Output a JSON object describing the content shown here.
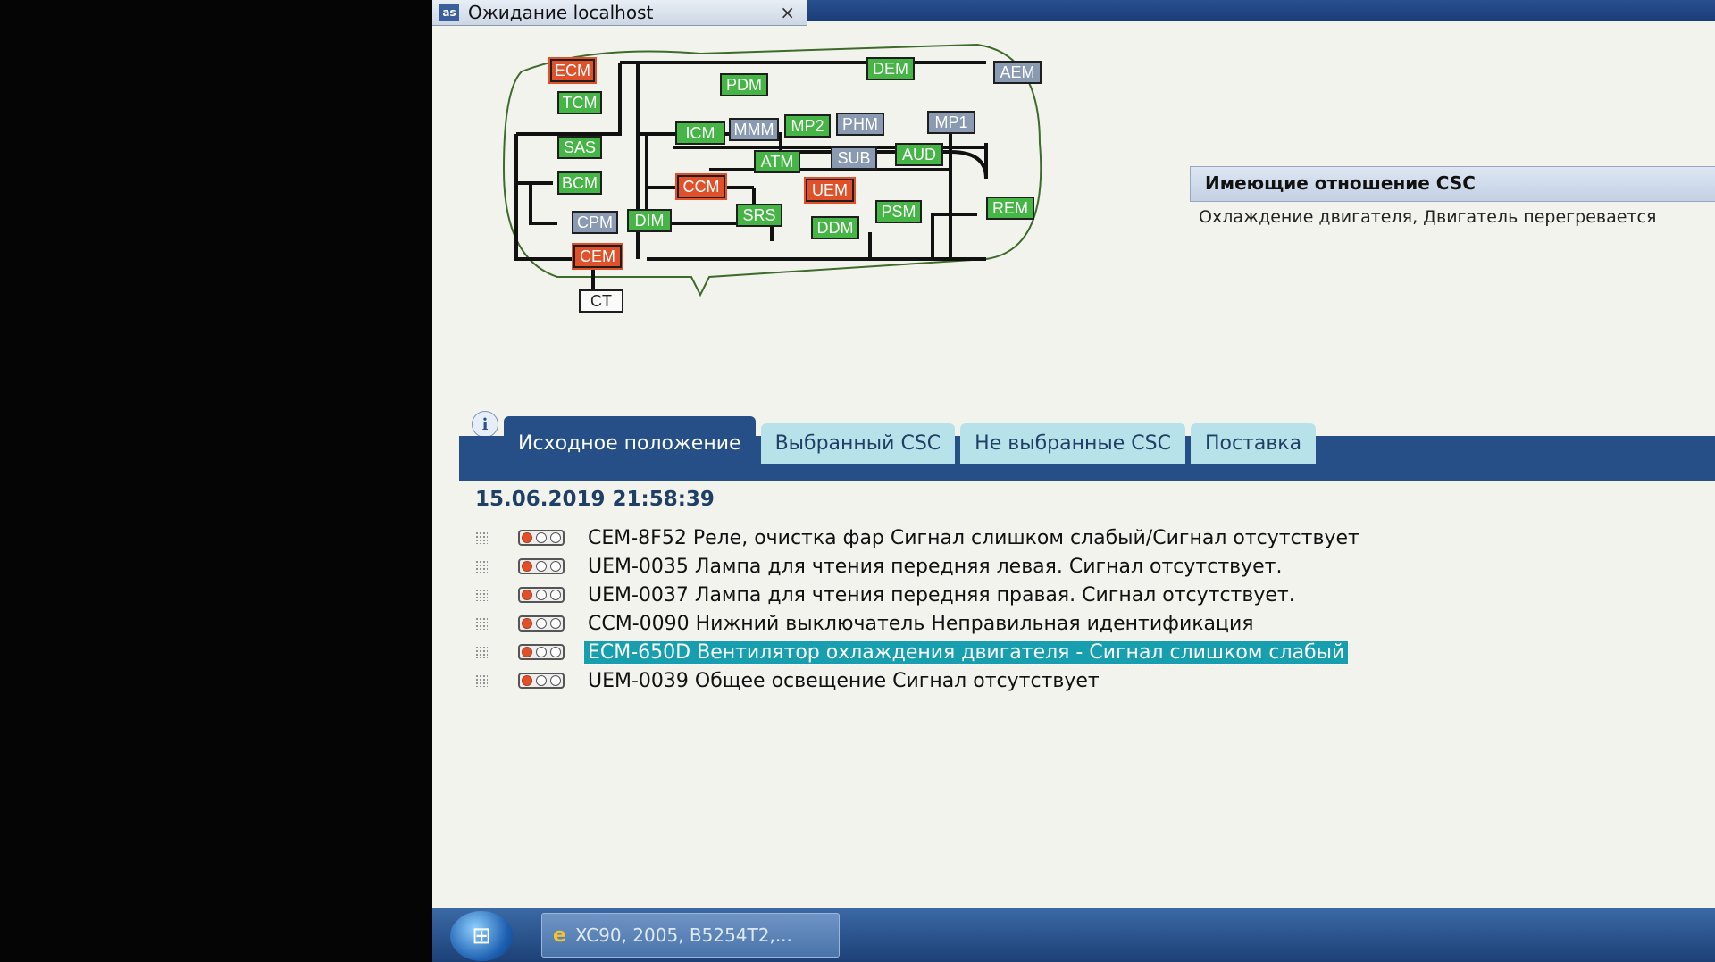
{
  "window": {
    "title": "Ожидание localhost",
    "close_glyph": "×",
    "app_icon": "as"
  },
  "topology": {
    "nodes": [
      {
        "id": "ECM",
        "status": "error"
      },
      {
        "id": "TCM",
        "status": "ok"
      },
      {
        "id": "SAS",
        "status": "ok"
      },
      {
        "id": "BCM",
        "status": "ok"
      },
      {
        "id": "CPM",
        "status": "inactive"
      },
      {
        "id": "DIM",
        "status": "ok"
      },
      {
        "id": "CEM",
        "status": "error"
      },
      {
        "id": "CT",
        "status": "plain"
      },
      {
        "id": "PDM",
        "status": "ok"
      },
      {
        "id": "DEM",
        "status": "ok"
      },
      {
        "id": "AEM",
        "status": "inactive"
      },
      {
        "id": "ICM",
        "status": "ok"
      },
      {
        "id": "MMM",
        "status": "inactive"
      },
      {
        "id": "MP2",
        "status": "ok"
      },
      {
        "id": "PHM",
        "status": "inactive"
      },
      {
        "id": "MP1",
        "status": "inactive"
      },
      {
        "id": "ATM",
        "status": "ok"
      },
      {
        "id": "SUB",
        "status": "inactive"
      },
      {
        "id": "AUD",
        "status": "ok"
      },
      {
        "id": "CCM",
        "status": "error"
      },
      {
        "id": "UEM",
        "status": "error"
      },
      {
        "id": "SRS",
        "status": "ok"
      },
      {
        "id": "DDM",
        "status": "ok"
      },
      {
        "id": "PSM",
        "status": "ok"
      },
      {
        "id": "REM",
        "status": "ok"
      }
    ]
  },
  "side_panel": {
    "heading": "Имеющие отношение CSC",
    "text": "Охлаждение двигателя, Двигатель перегревается"
  },
  "info_icon": "info-icon",
  "tabs": [
    {
      "label": "Исходное положение",
      "active": true
    },
    {
      "label": "Выбранный CSC",
      "active": false
    },
    {
      "label": "Не выбранные CSC",
      "active": false
    },
    {
      "label": "Поставка",
      "active": false
    }
  ],
  "timestamp": "15.06.2019 21:58:39",
  "errors": [
    {
      "text": "CEM-8F52 Реле, очистка фар Сигнал слишком слабый/Сигнал отсутствует",
      "selected": false
    },
    {
      "text": "UEM-0035 Лампа для чтения передняя левая. Сигнал отсутствует.",
      "selected": false
    },
    {
      "text": "UEM-0037 Лампа для чтения передняя правая. Сигнал отсутствует.",
      "selected": false
    },
    {
      "text": "CCM-0090 Нижний выключатель Неправильная идентификация",
      "selected": false
    },
    {
      "text": "ECM-650D Вентилятор охлаждения двигателя - Сигнал слишком слабый",
      "selected": true
    },
    {
      "text": "UEM-0039 Общее освещение Сигнал отсутствует",
      "selected": false
    }
  ],
  "taskbar": {
    "start_icon": "windows-start-icon",
    "item_label": "XC90, 2005, B5254T2,...",
    "item_icon": "e"
  }
}
